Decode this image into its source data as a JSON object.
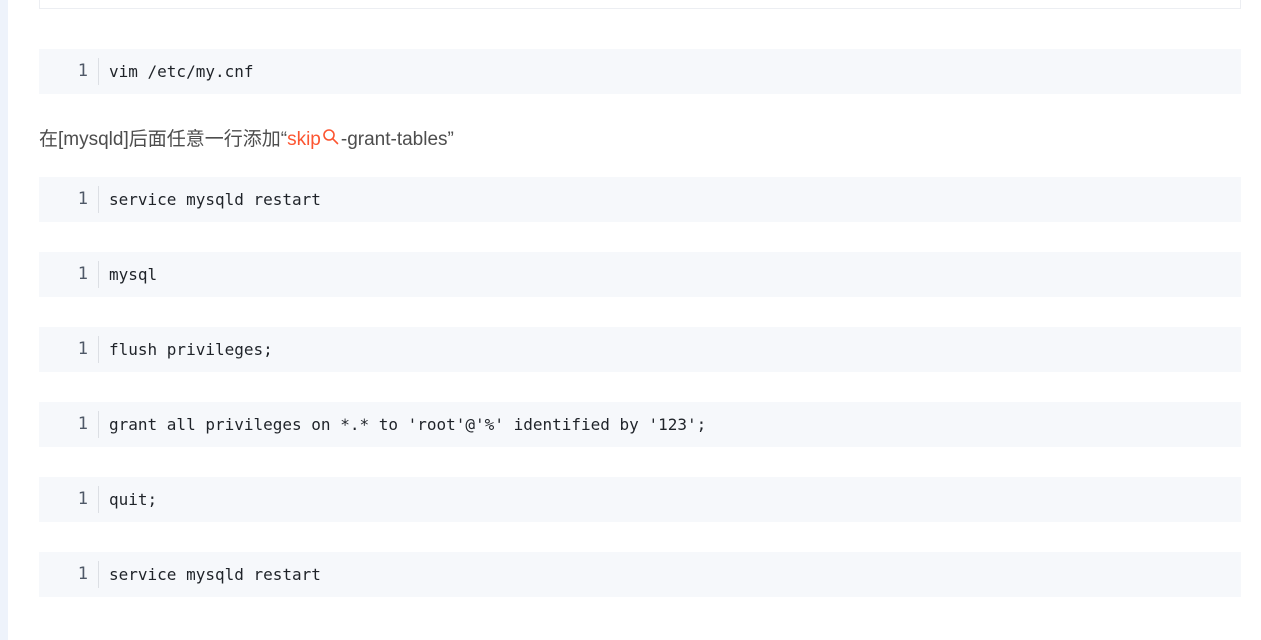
{
  "paragraph": {
    "prefix": "在[mysqld]后面任意一行添加“",
    "keyword": "skip",
    "suffix": "-grant-tables”",
    "keyword_color": "#fc5531",
    "keyword_icon": "search-icon"
  },
  "code_blocks": [
    {
      "line": "1",
      "code": "vim /etc/my.cnf"
    },
    {
      "line": "1",
      "code": "service mysqld restart"
    },
    {
      "line": "1",
      "code": "mysql"
    },
    {
      "line": "1",
      "code": "flush privileges;"
    },
    {
      "line": "1",
      "code": "grant all privileges on *.* to 'root'@'%' identified by '123';"
    },
    {
      "line": "1",
      "code": "quit;"
    },
    {
      "line": "1",
      "code": "service mysqld restart"
    }
  ]
}
